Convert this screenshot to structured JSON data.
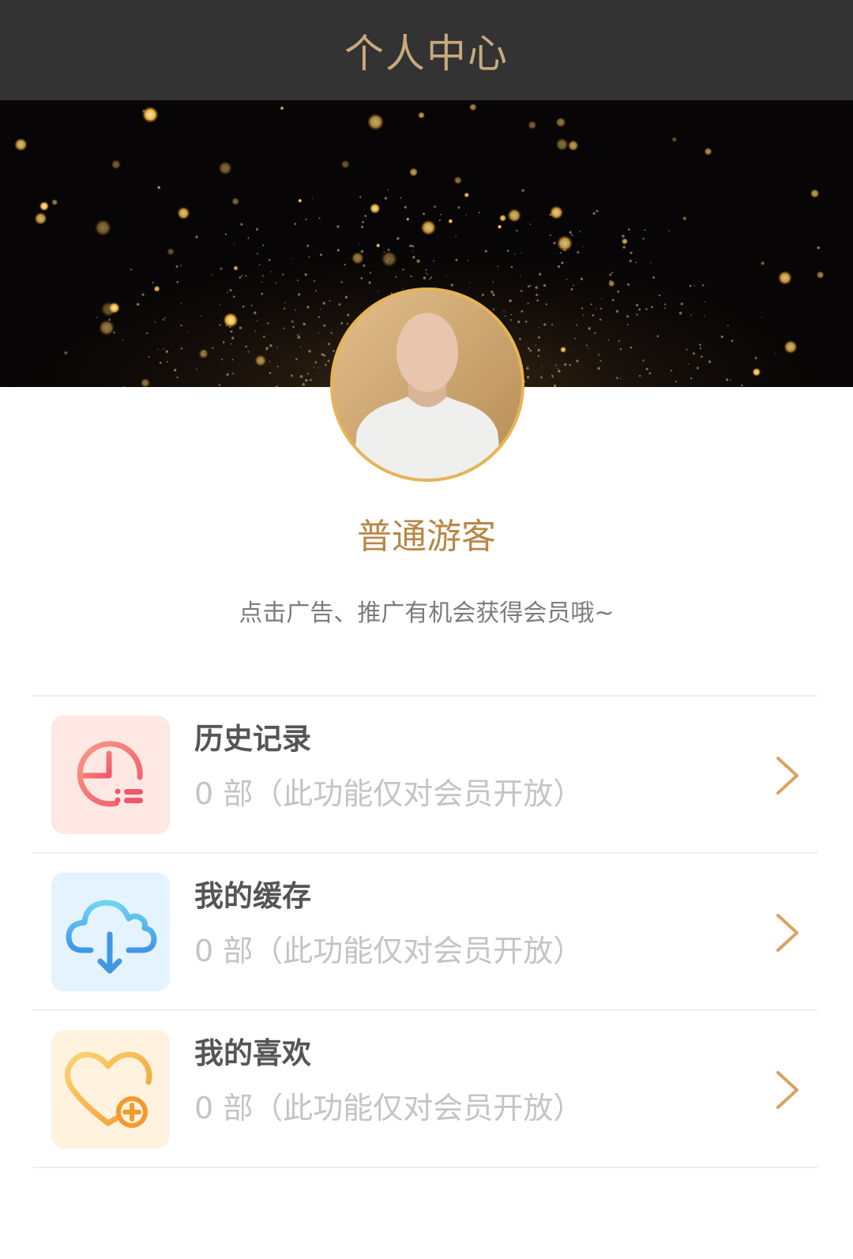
{
  "header": {
    "title": "个人中心"
  },
  "profile": {
    "username": "普通游客",
    "tip": "点击广告、推广有机会获得会员哦~"
  },
  "colors": {
    "topbar_bg": "#333333",
    "title_color": "#c9a97e",
    "username_color": "#b98747",
    "avatar_border": "#e6b457",
    "chevron": "#d9a35f"
  },
  "menu": [
    {
      "label": "历史记录",
      "desc": "0 部（此功能仅对会员开放）",
      "icon": "history-clock-icon",
      "icon_bg": "#fde8e3"
    },
    {
      "label": "我的缓存",
      "desc": "0 部（此功能仅对会员开放）",
      "icon": "cloud-download-icon",
      "icon_bg": "#e4f3fd"
    },
    {
      "label": "我的喜欢",
      "desc": "0 部（此功能仅对会员开放）",
      "icon": "heart-plus-icon",
      "icon_bg": "#fff2df"
    }
  ]
}
